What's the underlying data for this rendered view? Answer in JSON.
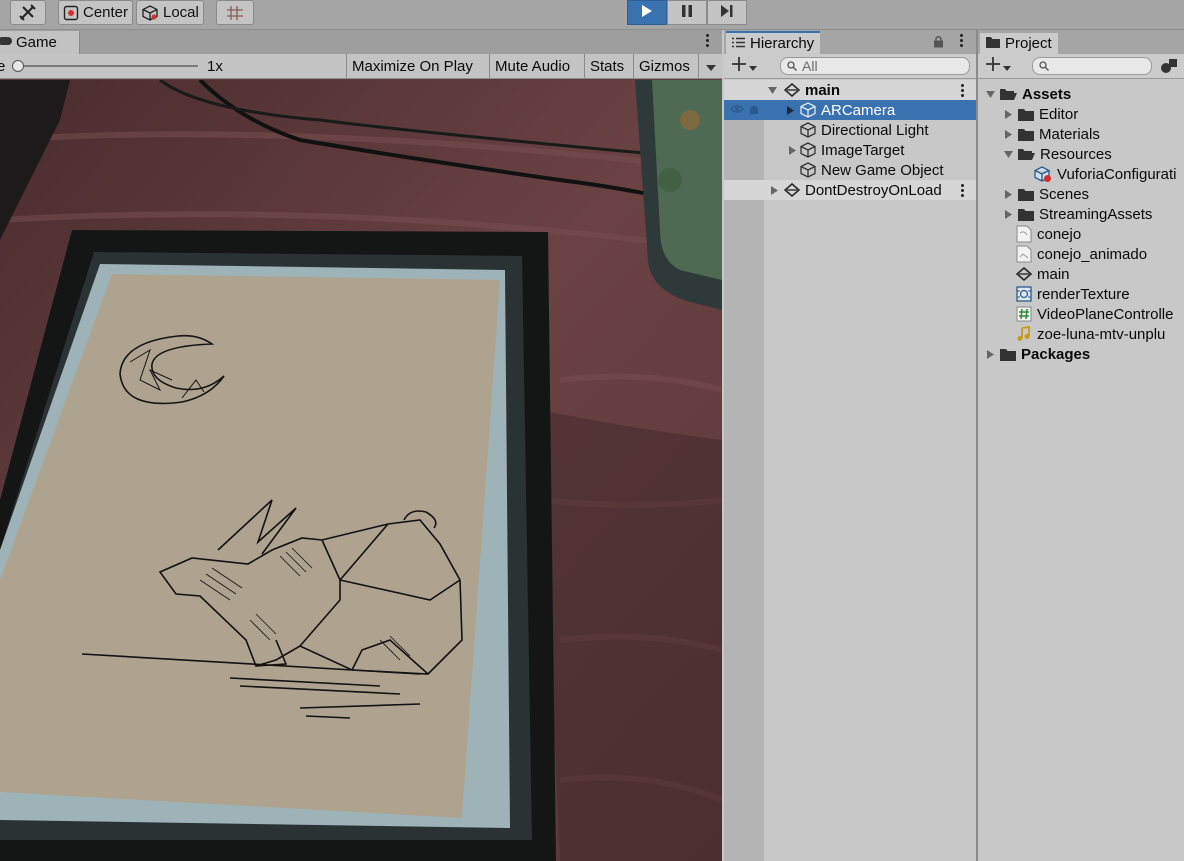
{
  "toolbar": {
    "pivot_label": "Center",
    "space_label": "Local"
  },
  "game": {
    "tab_label": "Game",
    "scale_label": "e",
    "scale_value": "1x",
    "buttons": [
      "Maximize On Play",
      "Mute Audio",
      "Stats",
      "Gizmos"
    ]
  },
  "hierarchy": {
    "tab_label": "Hierarchy",
    "search_placeholder": "All",
    "scene": "main",
    "items": [
      {
        "label": "ARCamera",
        "selected": true,
        "expandable": true
      },
      {
        "label": "Directional Light",
        "selected": false,
        "expandable": false
      },
      {
        "label": "ImageTarget",
        "selected": false,
        "expandable": true
      },
      {
        "label": "New Game Object",
        "selected": false,
        "expandable": false
      }
    ],
    "dont_destroy": "DontDestroyOnLoad"
  },
  "project": {
    "tab_label": "Project",
    "root": "Assets",
    "folders": {
      "editor": "Editor",
      "materials": "Materials",
      "resources": "Resources",
      "vuforia": "VuforiaConfigurati",
      "scenes": "Scenes",
      "streaming": "StreamingAssets"
    },
    "files": {
      "conejo": "conejo",
      "conejo_animado": "conejo_animado",
      "main": "main",
      "render_texture": "renderTexture",
      "video_controller": "VideoPlaneControlle",
      "audio": "zoe-luna-mtv-unplu"
    },
    "packages": "Packages"
  },
  "colors": {
    "selection": "#3a72b0",
    "panel_bg": "#c8c8c8",
    "toolbar_bg": "#a5a5a5"
  }
}
